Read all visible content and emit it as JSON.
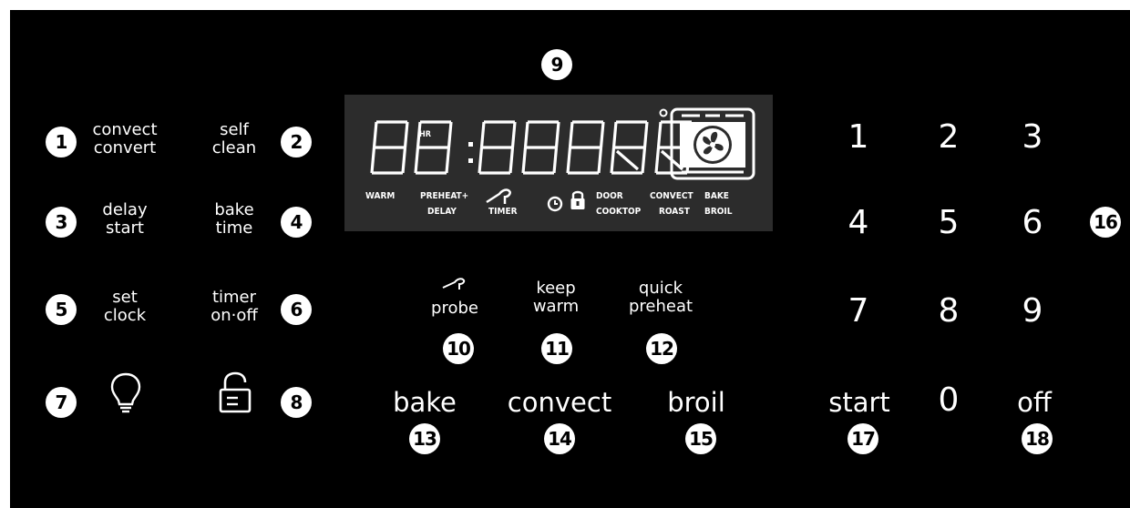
{
  "colors": {
    "background": "#000000",
    "display": "#2c2c2c",
    "foreground": "#ffffff"
  },
  "left_buttons": [
    {
      "number": "1",
      "lines": [
        "convect",
        "convert"
      ]
    },
    {
      "number": "2",
      "lines": [
        "self",
        "clean"
      ]
    },
    {
      "number": "3",
      "lines": [
        "delay",
        "start"
      ]
    },
    {
      "number": "4",
      "lines": [
        "bake",
        "time"
      ]
    },
    {
      "number": "5",
      "lines": [
        "set",
        "clock"
      ]
    },
    {
      "number": "6",
      "lines": [
        "timer",
        "on·off"
      ]
    },
    {
      "number": "7",
      "icon": "light-bulb-icon"
    },
    {
      "number": "8",
      "icon": "lock-icon"
    }
  ],
  "display": {
    "number": "9",
    "hr_label": "HR",
    "indicators": {
      "warm": "WARM",
      "preheat": "PREHEAT+",
      "delay": "DELAY",
      "timer": "TIMER",
      "door": "DOOR",
      "cooktop": "COOKTOP",
      "convect": "CONVECT",
      "roast": "ROAST",
      "bake": "BAKE",
      "broil": "BROIL"
    },
    "icons": [
      "probe-icon",
      "clock-icon",
      "lock-icon",
      "oven-fan-icon",
      "degree-icon"
    ]
  },
  "middle_buttons": [
    {
      "number": "10",
      "lines": [
        "probe"
      ],
      "icon": "probe-icon"
    },
    {
      "number": "11",
      "lines": [
        "keep",
        "warm"
      ]
    },
    {
      "number": "12",
      "lines": [
        "quick",
        "preheat"
      ]
    }
  ],
  "mode_buttons": [
    {
      "number": "13",
      "label": "bake"
    },
    {
      "number": "14",
      "label": "convect"
    },
    {
      "number": "15",
      "label": "broil"
    }
  ],
  "keypad": {
    "number": "16",
    "keys": [
      "1",
      "2",
      "3",
      "4",
      "5",
      "6",
      "7",
      "8",
      "9",
      "0"
    ]
  },
  "action_buttons": [
    {
      "number": "17",
      "label": "start"
    },
    {
      "number": "18",
      "label": "off"
    }
  ]
}
